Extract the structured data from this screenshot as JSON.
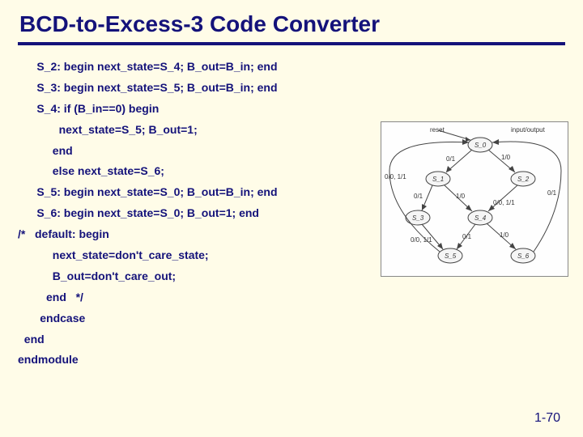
{
  "title": "BCD-to-Excess-3 Code Converter",
  "code": {
    "l1": "      S_2: begin next_state=S_4; B_out=B_in; end",
    "l2": "      S_3: begin next_state=S_5; B_out=B_in; end",
    "l3": "      S_4: if (B_in==0) begin",
    "l4": "             next_state=S_5; B_out=1;",
    "l5": "           end",
    "l6": "           else next_state=S_6;",
    "l7": "      S_5: begin next_state=S_0; B_out=B_in; end",
    "l8": "      S_6: begin next_state=S_0; B_out=1; end",
    "l9": "/*   default: begin",
    "l10": "           next_state=don't_care_state;",
    "l11": "           B_out=don't_care_out;",
    "l12": "         end   */",
    "l13": "       endcase",
    "l14": "  end",
    "l15": "endmodule"
  },
  "pagenum": "1-70",
  "diagram": {
    "top_labels": {
      "reset": "reset",
      "io": "input/output"
    },
    "nodes": {
      "s0": "S_0",
      "s1": "S_1",
      "s2": "S_2",
      "s3": "S_3",
      "s4": "S_4",
      "s5": "S_5",
      "s6": "S_6"
    },
    "edges": {
      "s0_s1": "0/1",
      "s0_s2": "1/0",
      "s1_s3": "0/1",
      "s1_s4": "1/0",
      "s2_s4": "0/0, 1/1",
      "s3_s5": "0/0, 1/1",
      "s4_s5": "0/1",
      "s4_s6": "1/0",
      "s5_s0": "0/0, 1/1",
      "s6_s0": "0/1"
    }
  }
}
